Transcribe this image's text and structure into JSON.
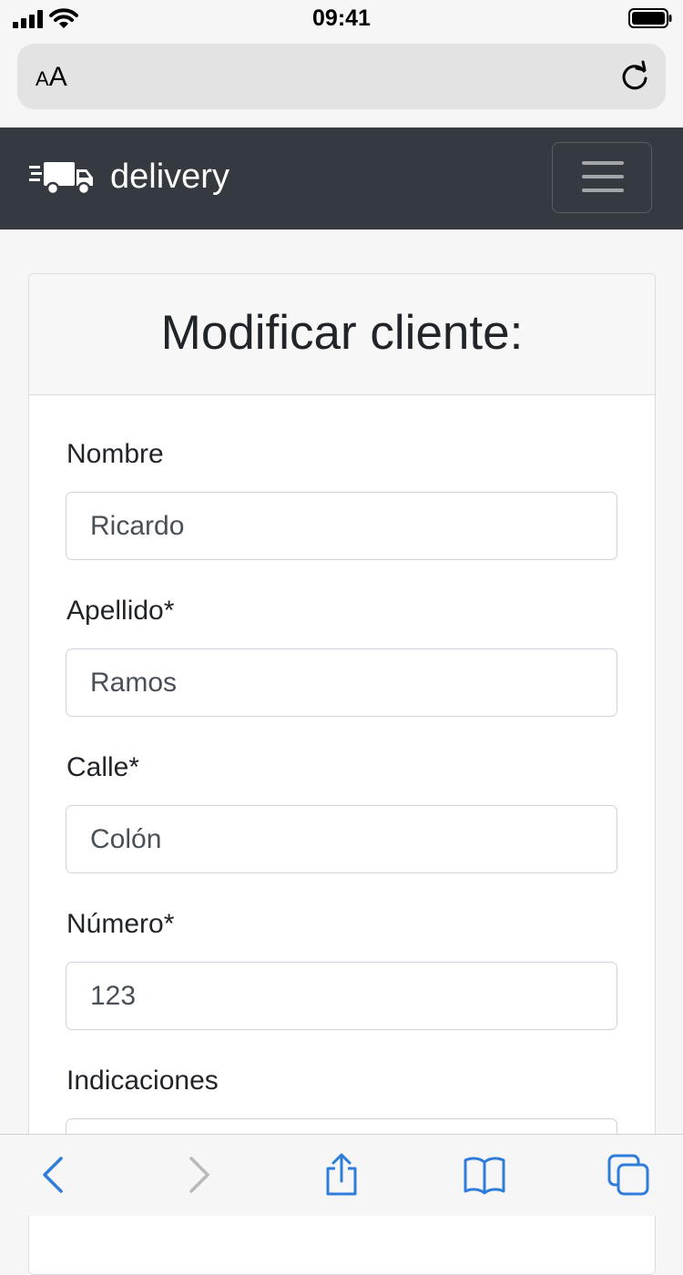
{
  "status_bar": {
    "time": "09:41"
  },
  "browser": {
    "aa_small": "A",
    "aa_big": "A"
  },
  "navbar": {
    "brand": "delivery"
  },
  "card": {
    "title": "Modificar cliente:"
  },
  "form": {
    "fields": [
      {
        "label": "Nombre",
        "value": "Ricardo"
      },
      {
        "label": "Apellido*",
        "value": "Ramos"
      },
      {
        "label": "Calle*",
        "value": "Colón"
      },
      {
        "label": "Número*",
        "value": "123"
      },
      {
        "label": "Indicaciones",
        "value": ""
      }
    ]
  },
  "colors": {
    "navbar": "#343a40",
    "accent": "#2f7ddb",
    "toolbar_disabled": "#b9b9b9"
  }
}
